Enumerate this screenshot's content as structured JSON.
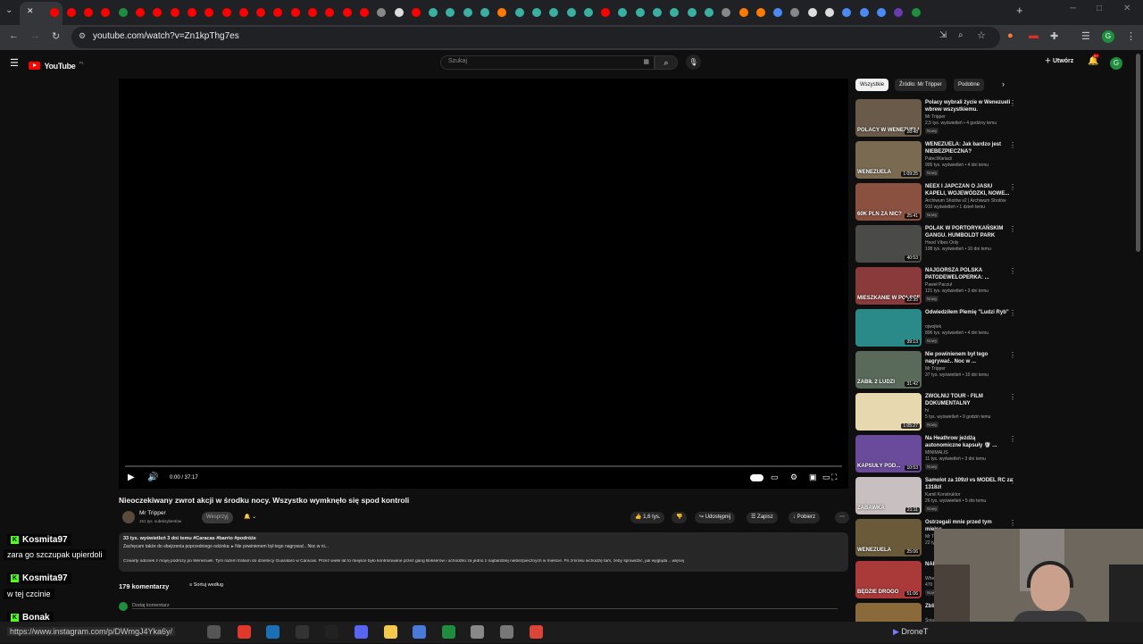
{
  "browser": {
    "url": "youtube.com/watch?v=Zn1kpThg7es",
    "close_tab": "✕",
    "new_tab": "+"
  },
  "youtube": {
    "logo_text": "YouTube",
    "logo_region": "PL",
    "search_placeholder": "Szukaj",
    "create_label": "Utwórz",
    "notif_count": "9+",
    "avatar_letter": "G"
  },
  "player": {
    "time": "0:00 / 37:17",
    "progress": 0.0
  },
  "video": {
    "title": "Nieoczekiwany zwrot akcji w środku nocy. Wszystko wymknęło się spod kontroli",
    "channel": "Mr Tripper",
    "subscribers": "151 tys. subskrybentów",
    "support_label": "Wesprzyj",
    "likes": "1,6 tys.",
    "share_label": "Udostępnij",
    "save_label": "Zapisz",
    "download_label": "Pobierz",
    "desc_stats": "33 tys. wyświetleń  3 dni temu  #Caracas #barrio #podróże",
    "desc_line1": "Zachęcam także do obejrzenia poprzedniego odcinka:  ▸ Nie powinienem był tego nagrywać.. Noc w ni...",
    "desc_line2": "Czwarty odcinek z mojej podróży po Wenezueli. Tym razem trafiam do dzielnicy Guarataro w Caracas. Przez wiele lat to miejsce było kontrolowane przez gang Bokserów i uchodziło za jedno z najbardziej niebezpiecznych w mieście. Po zmroku wchodzę tam, żeby sprawdzić, jak wygląda ...więcej",
    "comments_count": "179 komentarzy",
    "sort_label": "Sortuj według",
    "add_comment": "Dodaj komentarz"
  },
  "chips": [
    "Wszystkie",
    "Źródło: Mr Tripper",
    "Podobne"
  ],
  "recommendations": [
    {
      "title": "Polacy wybrali życie w Wenezueli wbrew wszystkiemu.",
      "channel": "Mr Tripper",
      "meta": "2,5 tys. wyświetleń • 4 godziny temu",
      "badge": "Nowy",
      "duration": "28:48",
      "overlay": "POLACY W WENEZUELI",
      "color": "#6a5a4a"
    },
    {
      "title": "WENEZUELA: Jak bardzo jest NIEBEZPIECZNA?",
      "channel": "PatecWariacii",
      "meta": "906 tys. wyświetleń • 4 dni temu",
      "badge": "Nowy",
      "duration": "1:09:25",
      "overlay": "WENEZUELA",
      "color": "#7a6a52"
    },
    {
      "title": "NEEX I JAPCZAN O JASIU KAPELI, WOJEWÓDZKI, NOWE...",
      "channel": "Archiwum Shotów v2 | Archiwum Shotów",
      "meta": "910 wyświetleń • 1 dzień temu",
      "badge": "Nowy",
      "duration": "25:41",
      "overlay": "60K PLN ZA NIC?",
      "color": "#8a5040"
    },
    {
      "title": "POLAK W PORTORYKAŃSKIM GANGU. HUMBOLDT PARK",
      "channel": "Hood Vibes Only",
      "meta": "108 tys. wyświetleń • 10 dni temu",
      "badge": "",
      "duration": "40:53",
      "overlay": "",
      "color": "#4a4a48"
    },
    {
      "title": "NAJGORSZA POLSKA PATODEWELOPERKA: ...",
      "channel": "Paweł Paczul",
      "meta": "121 tys. wyświetleń • 3 dni temu",
      "badge": "Nowy",
      "duration": "22:35",
      "overlay": "MIESZKANIE W POLSCE",
      "color": "#8a3a3a"
    },
    {
      "title": "Odwiedziłem Plemię \"Ludzi Ryb\"",
      "channel": "ojwojtek",
      "meta": "806 tys. wyświetleń • 4 dni temu",
      "badge": "Nowy",
      "duration": "39:13",
      "overlay": "",
      "color": "#2a8a8a"
    },
    {
      "title": "Nie powinienem był tego nagrywać.. Noc w ...",
      "channel": "Mr Tripper",
      "meta": "37 tys. wyświetleń • 10 dni temu",
      "badge": "",
      "duration": "31:42",
      "overlay": "ZABIŁ 2 LUDZI",
      "color": "#5a6a5a"
    },
    {
      "title": "ZWOLNIJ TOUR - FILM DOKUMENTALNY",
      "channel": "hi",
      "meta": "5 tys. wyświetleń • 9 godzin temu",
      "badge": "Nowy",
      "duration": "1:05:27",
      "overlay": "",
      "color": "#e8d8b0"
    },
    {
      "title": "Na Heathrow jeżdżą autonomiczne kapsuły 🛡 ...",
      "channel": "MINIMALIS",
      "meta": "11 tys. wyświetleń • 3 dni temu",
      "badge": "Nowy",
      "duration": "10:53",
      "overlay": "KAPSUŁY POD...",
      "color": "#6a4a9a"
    },
    {
      "title": "Samolot za 109zł vs MODEL RC za 1318zł",
      "channel": "Kamil Konstruktor",
      "meta": "26 tys. wyświetleń • 5 dni temu",
      "badge": "Nowy",
      "duration": "21:11",
      "overlay": "ZABAWKA",
      "color": "#c8c0c0"
    },
    {
      "title": "Ostrzegali mnie przed tym miejsc...",
      "channel": "Mr Tr",
      "meta": "22 tys.",
      "badge": "",
      "duration": "25:06",
      "overlay": "WENEZUELA",
      "color": "#6a5a3a"
    },
    {
      "title": "NAPI AUD...",
      "channel": "Wheel",
      "meta": "470 t",
      "badge": "Nowy",
      "duration": "51:06",
      "overlay": "BĘDZIE DROGO",
      "color": "#aa3a3a"
    },
    {
      "title": "Zbliż",
      "channel": "Śniad",
      "meta": "",
      "badge": "",
      "duration": "",
      "overlay": "",
      "color": "#8a6a3a"
    }
  ],
  "chat": [
    {
      "user": "Kosmita97",
      "message": "zara go szczupak upierdoli"
    },
    {
      "user": "Kosmita97",
      "message": "w tej czcinie"
    },
    {
      "user": "Bonak",
      "message": ""
    }
  ],
  "taskbar": {
    "status_url": "https://www.instagram.com/p/DWmgJ4Yka6y/",
    "app_label": "DroneT"
  },
  "colors": {
    "yt_red": "#ff0000",
    "kick_green": "#53fc18",
    "bg": "#0f0f0f"
  }
}
